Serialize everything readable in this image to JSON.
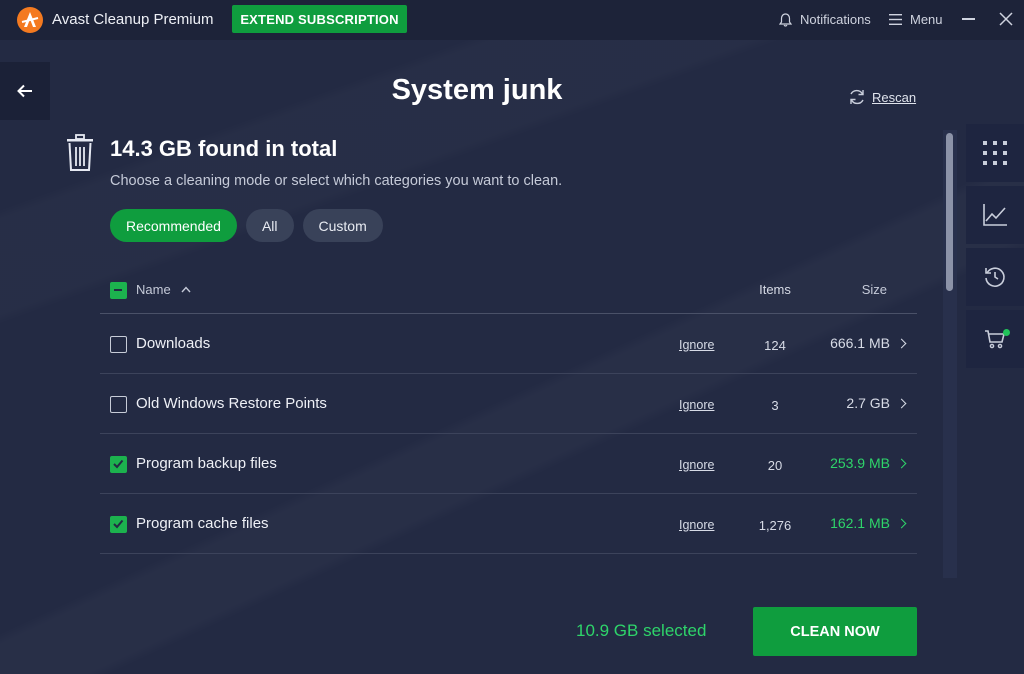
{
  "app": {
    "title": "Avast Cleanup Premium"
  },
  "header": {
    "extend_label": "EXTEND SUBSCRIPTION",
    "notifications_label": "Notifications",
    "menu_label": "Menu"
  },
  "page": {
    "title": "System junk",
    "rescan_label": "Rescan",
    "found_title": "14.3 GB found in total",
    "found_subtitle": "Choose a cleaning mode or select which categories you want to clean."
  },
  "modes": [
    {
      "label": "Recommended",
      "active": true
    },
    {
      "label": "All",
      "active": false
    },
    {
      "label": "Custom",
      "active": false
    }
  ],
  "table": {
    "headers": {
      "name": "Name",
      "items": "Items",
      "size": "Size"
    },
    "rows": [
      {
        "name": "Downloads",
        "ignore": "Ignore",
        "items": "124",
        "size": "666.1 MB",
        "checked": false
      },
      {
        "name": "Old Windows Restore Points",
        "ignore": "Ignore",
        "items": "3",
        "size": "2.7 GB",
        "checked": false
      },
      {
        "name": "Program backup files",
        "ignore": "Ignore",
        "items": "20",
        "size": "253.9 MB",
        "checked": true
      },
      {
        "name": "Program cache files",
        "ignore": "Ignore",
        "items": "1,276",
        "size": "162.1 MB",
        "checked": true
      }
    ]
  },
  "footer": {
    "selected_text": "10.9 GB selected",
    "clean_label": "CLEAN NOW"
  },
  "colors": {
    "accent_green": "#0f9d3e",
    "selected_green": "#2ed46a",
    "background": "#232a43",
    "brand_orange": "#f47a20"
  },
  "icons": {
    "logo": "avast-logo-icon",
    "notifications": "bell-icon",
    "menu": "hamburger-icon",
    "back": "arrow-left-icon",
    "rescan": "refresh-icon",
    "trash": "trash-icon",
    "rail": [
      "grid-icon",
      "chart-icon",
      "history-icon",
      "cart-icon"
    ]
  }
}
